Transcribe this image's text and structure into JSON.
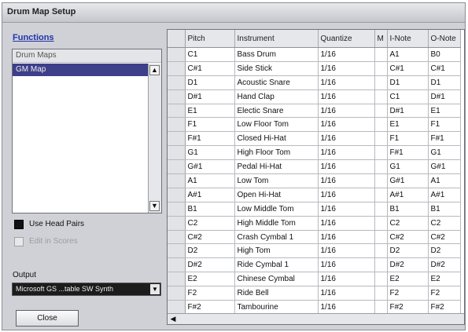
{
  "window": {
    "title": "Drum Map Setup"
  },
  "left": {
    "functions_label": "Functions",
    "map_list": {
      "header": "Drum Maps",
      "items": [
        "GM Map"
      ]
    },
    "checkboxes": [
      {
        "label": "Use Head Pairs",
        "checked": true,
        "enabled": true
      },
      {
        "label": "Edit in Scores",
        "checked": false,
        "enabled": false
      }
    ],
    "output_label": "Output",
    "output_value": "Microsoft GS ...table SW Synth",
    "close_label": "Close"
  },
  "table": {
    "columns": [
      "",
      "Pitch",
      "Instrument",
      "Quantize",
      "M",
      "I-Note",
      "O-Note"
    ],
    "rows": [
      [
        "C1",
        "Bass Drum",
        "1/16",
        "A1",
        "B0"
      ],
      [
        "C#1",
        "Side Stick",
        "1/16",
        "C#1",
        "C#1"
      ],
      [
        "D1",
        "Acoustic Snare",
        "1/16",
        "D1",
        "D1"
      ],
      [
        "D#1",
        "Hand Clap",
        "1/16",
        "C1",
        "D#1"
      ],
      [
        "E1",
        "Electic Snare",
        "1/16",
        "D#1",
        "E1"
      ],
      [
        "F1",
        "Low Floor Tom",
        "1/16",
        "E1",
        "F1"
      ],
      [
        "F#1",
        "Closed Hi-Hat",
        "1/16",
        "F1",
        "F#1"
      ],
      [
        "G1",
        "High Floor Tom",
        "1/16",
        "F#1",
        "G1"
      ],
      [
        "G#1",
        "Pedal Hi-Hat",
        "1/16",
        "G1",
        "G#1"
      ],
      [
        "A1",
        "Low Tom",
        "1/16",
        "G#1",
        "A1"
      ],
      [
        "A#1",
        "Open Hi-Hat",
        "1/16",
        "A#1",
        "A#1"
      ],
      [
        "B1",
        "Low Middle Tom",
        "1/16",
        "B1",
        "B1"
      ],
      [
        "C2",
        "High Middle Tom",
        "1/16",
        "C2",
        "C2"
      ],
      [
        "C#2",
        "Crash Cymbal 1",
        "1/16",
        "C#2",
        "C#2"
      ],
      [
        "D2",
        "High Tom",
        "1/16",
        "D2",
        "D2"
      ],
      [
        "D#2",
        "Ride Cymbal 1",
        "1/16",
        "D#2",
        "D#2"
      ],
      [
        "E2",
        "Chinese Cymbal",
        "1/16",
        "E2",
        "E2"
      ],
      [
        "F2",
        "Ride Bell",
        "1/16",
        "F2",
        "F2"
      ],
      [
        "F#2",
        "Tambourine",
        "1/16",
        "F#2",
        "F#2"
      ]
    ]
  }
}
